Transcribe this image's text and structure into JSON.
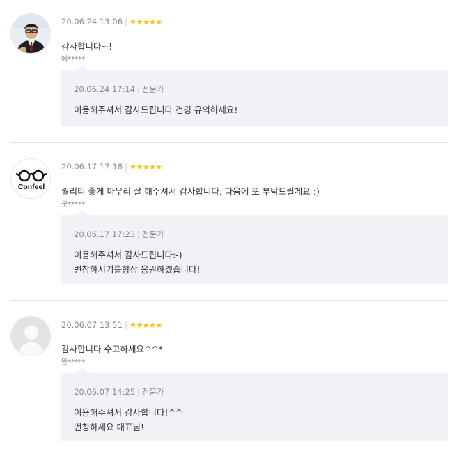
{
  "reviews": [
    {
      "datetime": "20.06.24 13:06",
      "stars": "★★★★★",
      "text": "감사합니다~!",
      "author": "에*****",
      "avatar": "person-photo",
      "reply": {
        "datetime": "20.06.24 17:14",
        "role": "전문가",
        "text": "이용해주셔서 감사드립니다 건깅 유의하세요!"
      }
    },
    {
      "datetime": "20.06.17 17:18",
      "stars": "★★★★★",
      "text": "퀄리티 좋게 마무리 잘 해주셔서 감사합니다, 다음에 또 부탁드릴게요 :)",
      "author": "굿*****",
      "avatar": "confeel-logo",
      "avatar_logo_text": "Confeel",
      "reply": {
        "datetime": "20.06.17 17:23",
        "role": "전문가",
        "text": "이용해주셔서 감사드립니다:-)\n번창하시기를항상 응원하겠습니다!"
      }
    },
    {
      "datetime": "20.06.07 13:51",
      "stars": "★★★★★",
      "text": "감사합니다 수고하세요^^*",
      "author": "완*****",
      "avatar": "default-user",
      "reply": {
        "datetime": "20.06.07 14:25",
        "role": "전문가",
        "text": "이용해주셔서 감사합니다!^^\n번창하세요 대표님!"
      }
    }
  ],
  "colors": {
    "star": "#f5c518",
    "reply_bg": "#f1f2f6",
    "meta_text": "#888888"
  }
}
